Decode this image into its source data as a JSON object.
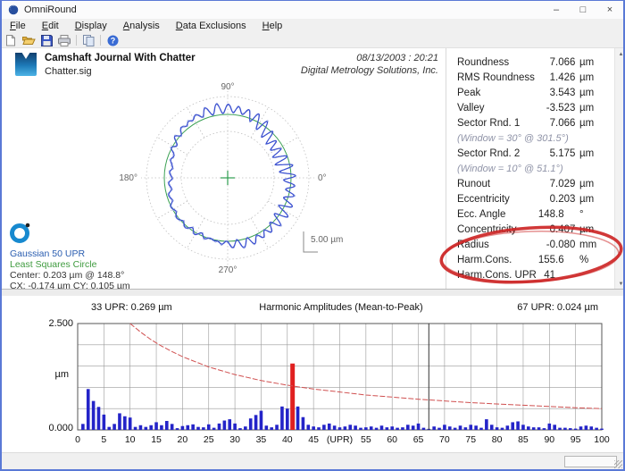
{
  "window": {
    "title": "OmniRound",
    "controls": {
      "minimize": "–",
      "maximize": "□",
      "close": "×"
    }
  },
  "menu": {
    "items": [
      {
        "label": "File",
        "accel_index": 0
      },
      {
        "label": "Edit",
        "accel_index": 0
      },
      {
        "label": "Display",
        "accel_index": 0
      },
      {
        "label": "Analysis",
        "accel_index": 0
      },
      {
        "label": "Data Exclusions",
        "accel_index": 0
      },
      {
        "label": "Help",
        "accel_index": 0
      }
    ]
  },
  "toolbar": {
    "icons": [
      "new-document-icon",
      "open-icon",
      "save-icon",
      "print-icon",
      "copy-icon",
      "help-icon"
    ],
    "help_glyph": "?"
  },
  "icons": {
    "scroll_up": "▲",
    "scroll_down": "▼"
  },
  "header": {
    "title": "Camshaft Journal With Chatter",
    "filename": "Chatter.sig",
    "datetime": "08/13/2003 : 20:21",
    "company": "Digital Metrology Solutions, Inc."
  },
  "results": {
    "rows": [
      {
        "label": "Roundness",
        "value": "7.066",
        "unit": "µm"
      },
      {
        "label": "RMS Roundness",
        "value": "1.426",
        "unit": "µm"
      },
      {
        "label": "Peak",
        "value": "3.543",
        "unit": "µm"
      },
      {
        "label": "Valley",
        "value": "-3.523",
        "unit": "µm"
      },
      {
        "label": "Sector Rnd. 1",
        "value": "7.066",
        "unit": "µm"
      },
      {
        "label": "(Window = 30° @ 301.5°)",
        "note": true
      },
      {
        "label": "Sector Rnd. 2",
        "value": "5.175",
        "unit": "µm"
      },
      {
        "label": "(Window = 10° @ 51.1°)",
        "note": true
      },
      {
        "label": "Runout",
        "value": "7.029",
        "unit": "µm"
      },
      {
        "label": "Eccentricity",
        "value": "0.203",
        "unit": "µm"
      },
      {
        "label": "Ecc. Angle",
        "value": "148.8",
        "unit": "°"
      },
      {
        "label": "Concentricity",
        "value": "0.407",
        "unit": "µm"
      },
      {
        "label": "Radius",
        "value": "-0.080",
        "unit": "mm"
      },
      {
        "label": "Harm.Cons.",
        "value": "155.6",
        "unit": "%"
      },
      {
        "label": "Harm.Cons. UPR",
        "value": "41",
        "unit": ""
      }
    ],
    "highlight_color": "#cc2222",
    "highlighted_rows": [
      "Harm.Cons.",
      "Harm.Cons. UPR"
    ]
  },
  "chart_data": [
    {
      "type": "polar_profile",
      "title": "Roundness polar plot",
      "angle_labels": {
        "right": "0°",
        "top": "90°",
        "left": "180°",
        "bottom": "270°"
      },
      "scale_label": "5.00 µm",
      "scale_um_per_division": 5.0,
      "legend": {
        "filter": "Gaussian 50 UPR",
        "reference": "Least Squares Circle",
        "center": "Center: 0.203 µm @ 148.8°",
        "cxcy": "CX: -0.174 µm  CY: 0.105 µm"
      },
      "profile_components": [
        {
          "upr": 2,
          "amp": 1.1,
          "phase": 2.6
        },
        {
          "upr": 3,
          "amp": 0.55,
          "phase": 1.2
        },
        {
          "upr": 5,
          "amp": 0.3,
          "phase": 0.4
        },
        {
          "upr": 33,
          "amp": 0.35,
          "phase": 0.0
        }
      ],
      "chatter": {
        "upr": 41,
        "amp": 1.4,
        "mod_phase": 0.3
      },
      "raw_extra": {
        "upr": 67,
        "amp": 0.3
      },
      "colors": {
        "grid": "#bfbfbf",
        "profile": "#3a4fd0",
        "raw": "#93a3e0",
        "reference": "#3aa052",
        "center_cross": "#2e9e4f"
      }
    },
    {
      "type": "bar",
      "title": "Harmonic Amplitudes (Mean-to-Peak)",
      "readout_left": "33 UPR:  0.269 µm",
      "readout_right": "67 UPR:  0.024 µm",
      "y_top_label": "2.500",
      "y_bottom_label": "0.000",
      "y_unit": "µm",
      "ylim": [
        0,
        2.5
      ],
      "y_grid_step": 0.5,
      "xlim": [
        0,
        100
      ],
      "x_grid_step": 5,
      "x_tick_labels": [
        "0",
        "5",
        "10",
        "15",
        "20",
        "25",
        "30",
        "35",
        "40",
        "45",
        "(UPR)",
        "55",
        "60",
        "65",
        "70",
        "75",
        "80",
        "85",
        "90",
        "95",
        "100"
      ],
      "values": [
        0.14,
        0.96,
        0.68,
        0.54,
        0.36,
        0.07,
        0.14,
        0.39,
        0.32,
        0.29,
        0.07,
        0.11,
        0.07,
        0.11,
        0.18,
        0.11,
        0.21,
        0.14,
        0.04,
        0.09,
        0.11,
        0.13,
        0.07,
        0.06,
        0.13,
        0.05,
        0.15,
        0.22,
        0.25,
        0.15,
        0.04,
        0.08,
        0.269,
        0.35,
        0.45,
        0.1,
        0.06,
        0.12,
        0.55,
        0.5,
        1.56,
        0.55,
        0.3,
        0.12,
        0.08,
        0.06,
        0.12,
        0.15,
        0.1,
        0.06,
        0.08,
        0.12,
        0.1,
        0.05,
        0.06,
        0.08,
        0.05,
        0.1,
        0.06,
        0.08,
        0.05,
        0.06,
        0.12,
        0.1,
        0.15,
        0.05,
        0.024,
        0.08,
        0.05,
        0.12,
        0.08,
        0.05,
        0.1,
        0.06,
        0.12,
        0.1,
        0.05,
        0.25,
        0.12,
        0.06,
        0.05,
        0.1,
        0.18,
        0.2,
        0.12,
        0.08,
        0.06,
        0.06,
        0.04,
        0.15,
        0.12,
        0.05,
        0.05,
        0.04,
        0.03,
        0.08,
        0.1,
        0.08,
        0.05,
        0.03
      ],
      "highlighted_upr": 41,
      "cursor_upr": 67,
      "limit_curve": [
        [
          10,
          2.5
        ],
        [
          12,
          2.3
        ],
        [
          14,
          2.12
        ],
        [
          16,
          1.97
        ],
        [
          18,
          1.84
        ],
        [
          20,
          1.72
        ],
        [
          25,
          1.48
        ],
        [
          30,
          1.3
        ],
        [
          35,
          1.16
        ],
        [
          40,
          1.05
        ],
        [
          45,
          0.96
        ],
        [
          50,
          0.89
        ],
        [
          55,
          0.82
        ],
        [
          60,
          0.77
        ],
        [
          65,
          0.72
        ],
        [
          70,
          0.68
        ],
        [
          75,
          0.64
        ],
        [
          80,
          0.61
        ],
        [
          85,
          0.58
        ],
        [
          90,
          0.55
        ],
        [
          95,
          0.52
        ],
        [
          100,
          0.5
        ]
      ],
      "colors": {
        "bar": "#2424c8",
        "highlight_bar": "#e02020",
        "limit_curve": "#d05050",
        "cursor": "#333333",
        "grid": "#9a9a9a"
      }
    }
  ]
}
